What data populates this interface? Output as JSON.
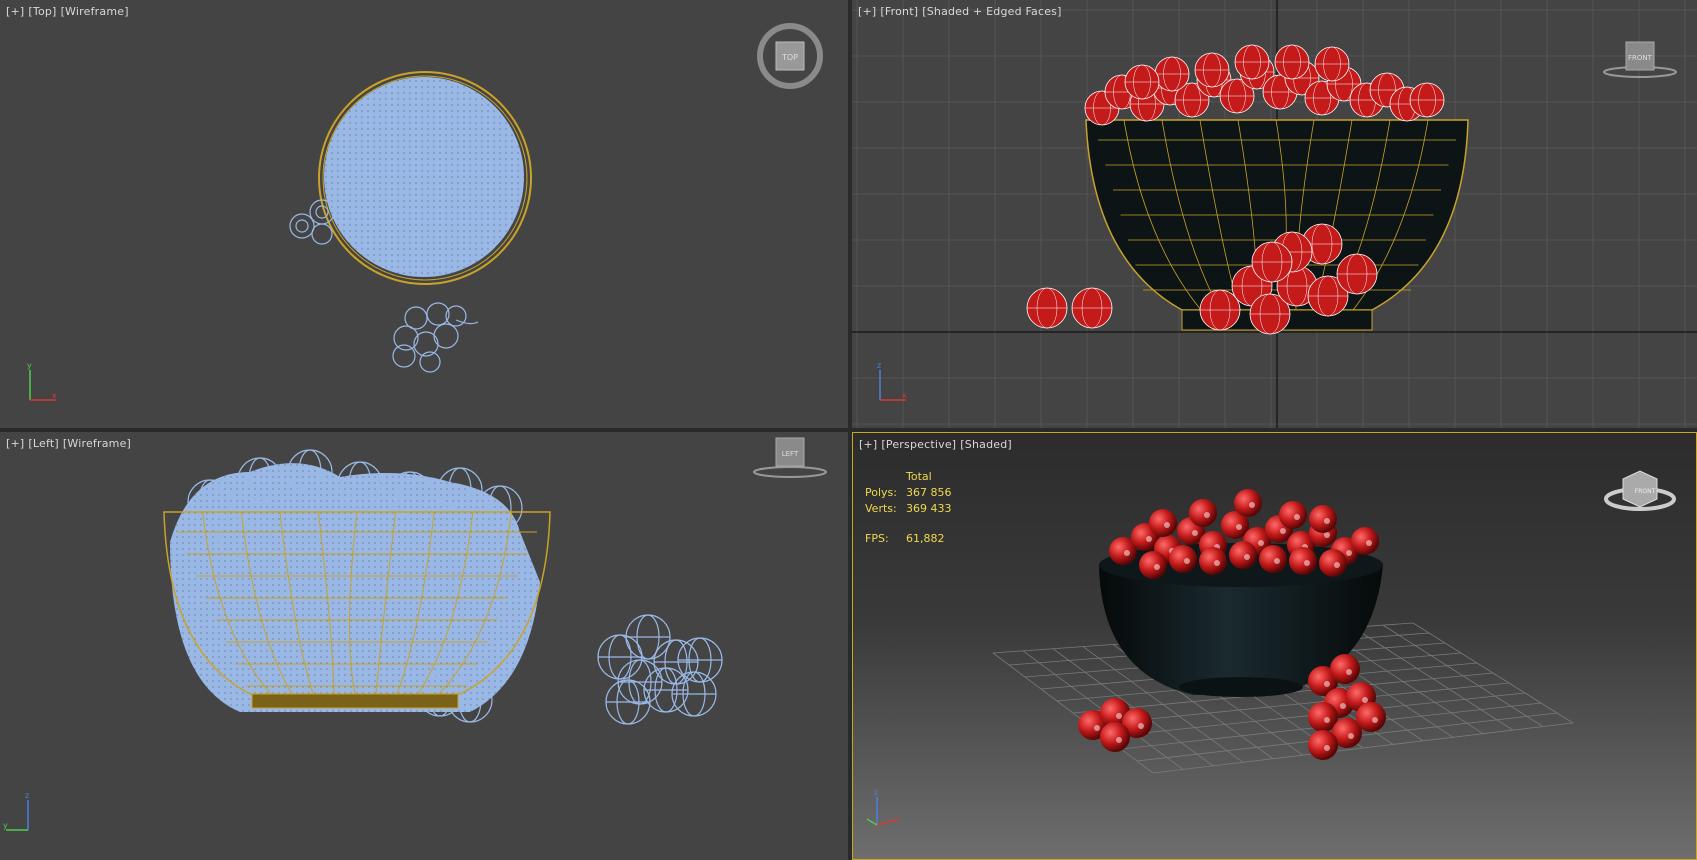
{
  "viewports": {
    "top": {
      "labels": [
        "[+]",
        "[Top]",
        "[Wireframe]"
      ],
      "viewcube_label": "TOP"
    },
    "front": {
      "labels": [
        "[+]",
        "[Front]",
        "[Shaded + Edged Faces]"
      ],
      "viewcube_label": "FRONT"
    },
    "left": {
      "labels": [
        "[+]",
        "[Left]",
        "[Wireframe]"
      ],
      "viewcube_label": "LEFT"
    },
    "perspective": {
      "labels": [
        "[+]",
        "[Perspective]",
        "[Shaded]"
      ],
      "viewcube_label": "FRONT"
    }
  },
  "stats": {
    "header": "Total",
    "polys_label": "Polys:",
    "polys_value": "367 856",
    "verts_label": "Verts:",
    "verts_value": "369 433",
    "fps_label": "FPS:",
    "fps_value": "61,882"
  },
  "colors": {
    "viewport_bg": "#444444",
    "wire_blue": "#9ab8e6",
    "wire_gold": "#c9a227",
    "cherry_red": "#c41a1a",
    "bowl_dark": "#0c1416",
    "stats_yellow": "#f0d850",
    "active_border": "#c8a81e"
  },
  "icons": [
    "viewcube-icon",
    "axis-tripod-icon"
  ]
}
